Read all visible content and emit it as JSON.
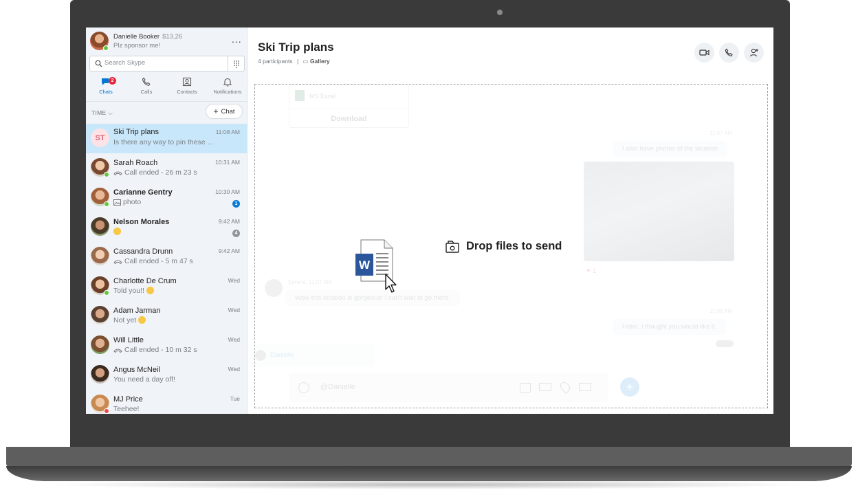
{
  "profile": {
    "name": "Danielle Booker",
    "credit": "$13,26",
    "mood": "Plz sponsor me!",
    "more_label": "..."
  },
  "search": {
    "placeholder": "Search Skype"
  },
  "nav": {
    "chats_label": "Chats",
    "chats_badge": "2",
    "calls_label": "Calls",
    "contacts_label": "Contacts",
    "notifications_label": "Notifications"
  },
  "list": {
    "sort_label": "TIME",
    "new_chat_label": "Chat"
  },
  "chats": [
    {
      "initials": "ST",
      "name": "Ski Trip plans",
      "preview": "Is there any way to pin these ...",
      "time": "11:08 AM"
    },
    {
      "name": "Sarah Roach",
      "preview": "Call ended - 26 m 23 s",
      "time": "10:31 AM"
    },
    {
      "name": "Carianne Gentry",
      "preview": "photo",
      "time": "10:30 AM",
      "unread": "1"
    },
    {
      "name": "Nelson Morales",
      "preview": "",
      "time": "9:42 AM",
      "unread": "4"
    },
    {
      "name": "Cassandra Drunn",
      "preview": "Call ended - 5 m 47 s",
      "time": "9:42 AM"
    },
    {
      "name": "Charlotte De Crum",
      "preview": "Told you!!",
      "time": "Wed"
    },
    {
      "name": "Adam Jarman",
      "preview": "Not yet",
      "time": "Wed"
    },
    {
      "name": "Will Little",
      "preview": "Call ended - 10 m 32 s",
      "time": "Wed"
    },
    {
      "name": "Angus McNeil",
      "preview": "You need a day off!",
      "time": "Wed"
    },
    {
      "name": "MJ Price",
      "preview": "Teehee!",
      "time": "Tue"
    }
  ],
  "conversation": {
    "title": "Ski Trip plans",
    "participants": "4 participants",
    "separator": "|",
    "gallery_label": "Gallery",
    "file_name": "MS Excel",
    "download_label": "Download",
    "time_1": "11:07 AM",
    "msg_photos": "I also have photos of the location",
    "reaction_count": "1",
    "serena_meta": "Serena, 11:07 AM",
    "msg_serena": "Wow this location is gorgeous! I can't wait to go there.",
    "time_2": "11:08 AM",
    "msg_reply": "Hehe. I thought you would like it.",
    "mention_suggestion": "Danielle",
    "compose_value": "@Danielle"
  },
  "drop": {
    "label": "Drop files to send"
  },
  "colors": {
    "accent": "#0078d4",
    "selected_row": "#c9e7fa",
    "badge": "#e5263b",
    "online": "#5cc93b"
  }
}
